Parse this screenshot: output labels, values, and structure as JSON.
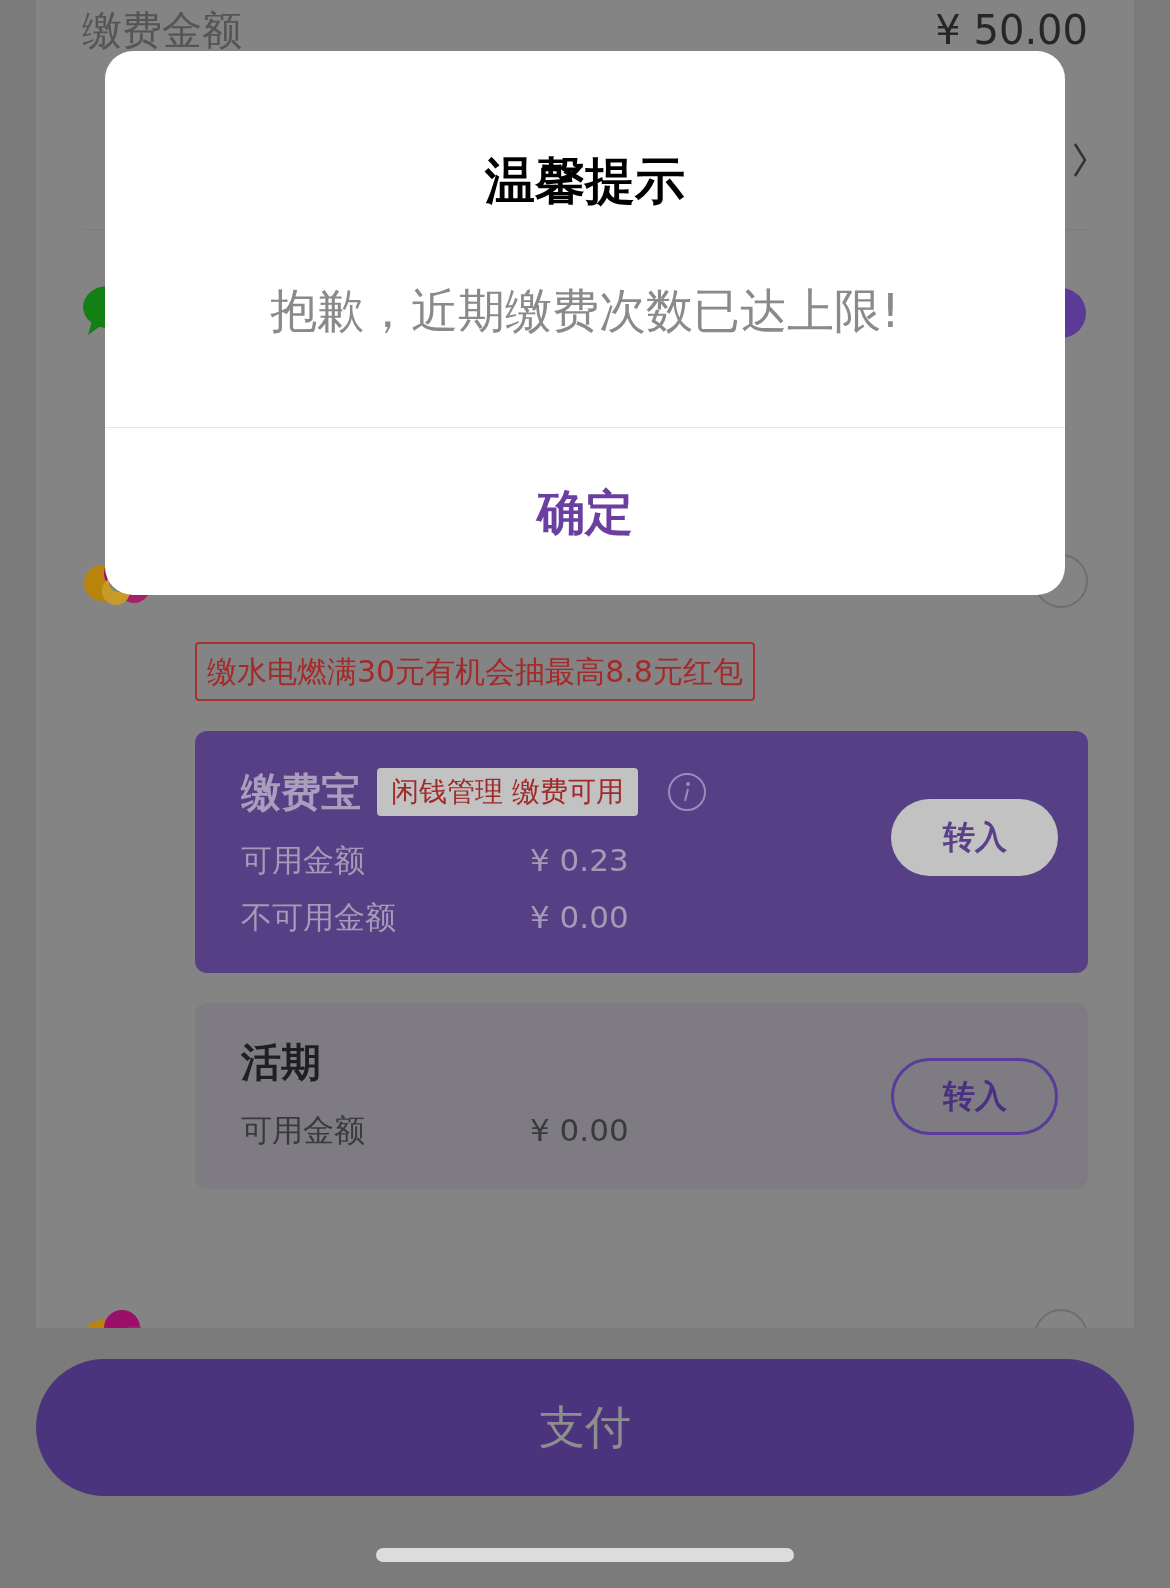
{
  "payment": {
    "amount_label": "缴费金额",
    "amount": "¥ 50.00"
  },
  "methods": [
    {
      "kind": "wechat",
      "selected": true
    },
    {
      "kind": "wallet",
      "selected": false
    },
    {
      "kind": "wallet",
      "selected": false
    }
  ],
  "promo": "缴水电燃满30元有机会抽最高8.8元红包",
  "accounts": [
    {
      "kind": "primary",
      "title": "缴费宝",
      "tag": "闲钱管理 缴费可用",
      "rows": [
        {
          "label": "可用金额",
          "value": "¥ 0.23"
        },
        {
          "label": "不可用金额",
          "value": "¥ 0.00"
        }
      ],
      "button": "转入"
    },
    {
      "kind": "plain",
      "title": "活期",
      "rows": [
        {
          "label": "可用金额",
          "value": "¥ 0.00"
        }
      ],
      "button": "转入"
    }
  ],
  "pay_button": "支付",
  "dialog": {
    "title": "温馨提示",
    "message": "抱歉，近期缴费次数已达上限!",
    "confirm": "确定"
  }
}
